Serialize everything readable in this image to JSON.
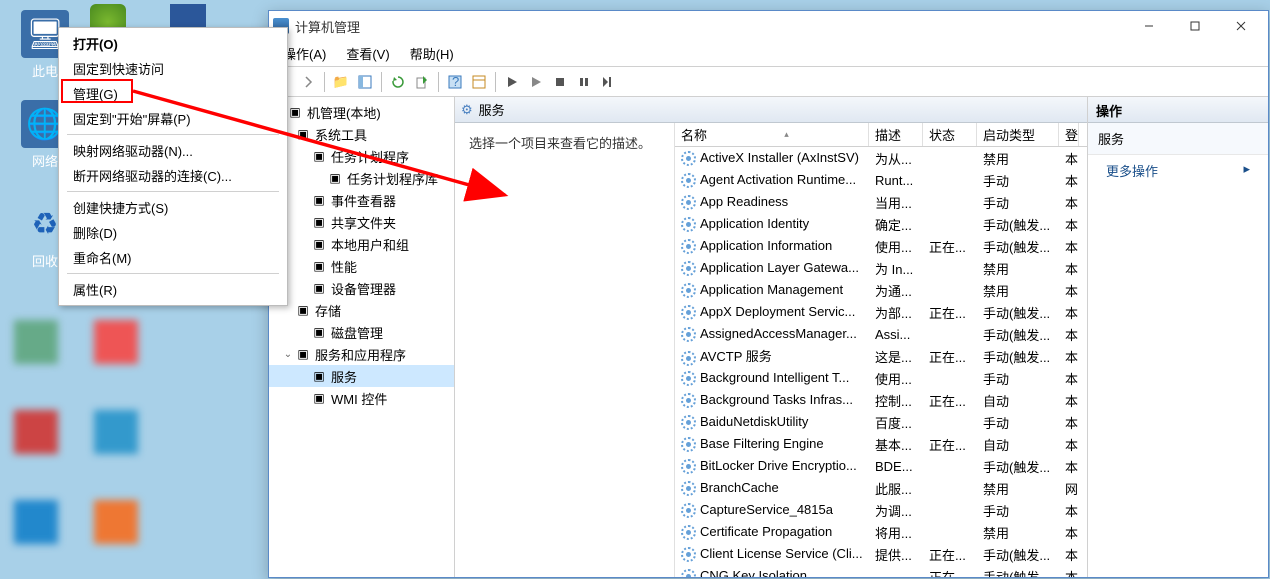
{
  "desktop": {
    "labels": {
      "thispc": "此电",
      "network": "网络",
      "recycle": "回收"
    }
  },
  "context_menu": {
    "items": [
      {
        "label": "打开(O)",
        "bold": true,
        "sep": false
      },
      {
        "label": "固定到快速访问",
        "sep": false
      },
      {
        "label": "管理(G)",
        "sep": false,
        "highlight": true
      },
      {
        "label": "固定到\"开始\"屏幕(P)",
        "sep": false
      },
      {
        "sep": true
      },
      {
        "label": "映射网络驱动器(N)...",
        "sep": false
      },
      {
        "label": "断开网络驱动器的连接(C)...",
        "sep": false
      },
      {
        "sep": true
      },
      {
        "label": "创建快捷方式(S)",
        "sep": false
      },
      {
        "label": "删除(D)",
        "sep": false
      },
      {
        "label": "重命名(M)",
        "sep": false
      },
      {
        "sep": true
      },
      {
        "label": "属性(R)",
        "sep": false
      }
    ]
  },
  "window": {
    "title": "计算机管理",
    "menus": [
      "操作(A)",
      "查看(V)",
      "帮助(H)"
    ],
    "pane_header": "服务",
    "ext_desc": "选择一个项目来查看它的描述。",
    "actions": {
      "title": "操作",
      "sub": "服务",
      "more": "更多操作"
    },
    "tree": [
      {
        "d": 0,
        "exp": "",
        "label": "机管理(本地)"
      },
      {
        "d": 1,
        "exp": "",
        "label": "系统工具"
      },
      {
        "d": 2,
        "exp": "",
        "label": "任务计划程序"
      },
      {
        "d": 3,
        "exp": "",
        "label": "任务计划程序库"
      },
      {
        "d": 2,
        "exp": "",
        "label": "事件查看器"
      },
      {
        "d": 2,
        "exp": "",
        "label": "共享文件夹"
      },
      {
        "d": 2,
        "exp": "",
        "label": "本地用户和组"
      },
      {
        "d": 2,
        "exp": "",
        "label": "性能"
      },
      {
        "d": 2,
        "exp": "",
        "label": "设备管理器"
      },
      {
        "d": 1,
        "exp": "",
        "label": "存储"
      },
      {
        "d": 2,
        "exp": "",
        "label": "磁盘管理"
      },
      {
        "d": 1,
        "exp": "v",
        "label": "服务和应用程序"
      },
      {
        "d": 2,
        "exp": "",
        "label": "服务",
        "sel": true
      },
      {
        "d": 2,
        "exp": "",
        "label": "WMI 控件"
      }
    ],
    "columns": {
      "name": "名称",
      "desc": "描述",
      "status": "状态",
      "startup": "启动类型",
      "logon": "登"
    },
    "services": [
      {
        "name": "ActiveX Installer (AxInstSV)",
        "desc": "为从...",
        "status": "",
        "startup": "禁用",
        "logon": "本"
      },
      {
        "name": "Agent Activation Runtime...",
        "desc": "Runt...",
        "status": "",
        "startup": "手动",
        "logon": "本"
      },
      {
        "name": "App Readiness",
        "desc": "当用...",
        "status": "",
        "startup": "手动",
        "logon": "本"
      },
      {
        "name": "Application Identity",
        "desc": "确定...",
        "status": "",
        "startup": "手动(触发...",
        "logon": "本"
      },
      {
        "name": "Application Information",
        "desc": "使用...",
        "status": "正在...",
        "startup": "手动(触发...",
        "logon": "本"
      },
      {
        "name": "Application Layer Gatewa...",
        "desc": "为 In...",
        "status": "",
        "startup": "禁用",
        "logon": "本"
      },
      {
        "name": "Application Management",
        "desc": "为通...",
        "status": "",
        "startup": "禁用",
        "logon": "本"
      },
      {
        "name": "AppX Deployment Servic...",
        "desc": "为部...",
        "status": "正在...",
        "startup": "手动(触发...",
        "logon": "本"
      },
      {
        "name": "AssignedAccessManager...",
        "desc": "Assi...",
        "status": "",
        "startup": "手动(触发...",
        "logon": "本"
      },
      {
        "name": "AVCTP 服务",
        "desc": "这是...",
        "status": "正在...",
        "startup": "手动(触发...",
        "logon": "本"
      },
      {
        "name": "Background Intelligent T...",
        "desc": "使用...",
        "status": "",
        "startup": "手动",
        "logon": "本"
      },
      {
        "name": "Background Tasks Infras...",
        "desc": "控制...",
        "status": "正在...",
        "startup": "自动",
        "logon": "本"
      },
      {
        "name": "BaiduNetdiskUtility",
        "desc": "百度...",
        "status": "",
        "startup": "手动",
        "logon": "本"
      },
      {
        "name": "Base Filtering Engine",
        "desc": "基本...",
        "status": "正在...",
        "startup": "自动",
        "logon": "本"
      },
      {
        "name": "BitLocker Drive Encryptio...",
        "desc": "BDE...",
        "status": "",
        "startup": "手动(触发...",
        "logon": "本"
      },
      {
        "name": "BranchCache",
        "desc": "此服...",
        "status": "",
        "startup": "禁用",
        "logon": "网"
      },
      {
        "name": "CaptureService_4815a",
        "desc": "为调...",
        "status": "",
        "startup": "手动",
        "logon": "本"
      },
      {
        "name": "Certificate Propagation",
        "desc": "将用...",
        "status": "",
        "startup": "禁用",
        "logon": "本"
      },
      {
        "name": "Client License Service (Cli...",
        "desc": "提供...",
        "status": "正在...",
        "startup": "手动(触发...",
        "logon": "本"
      },
      {
        "name": "CNG Key Isolation",
        "desc": "",
        "status": "正在...",
        "startup": "手动(触发...",
        "logon": "本"
      }
    ]
  }
}
